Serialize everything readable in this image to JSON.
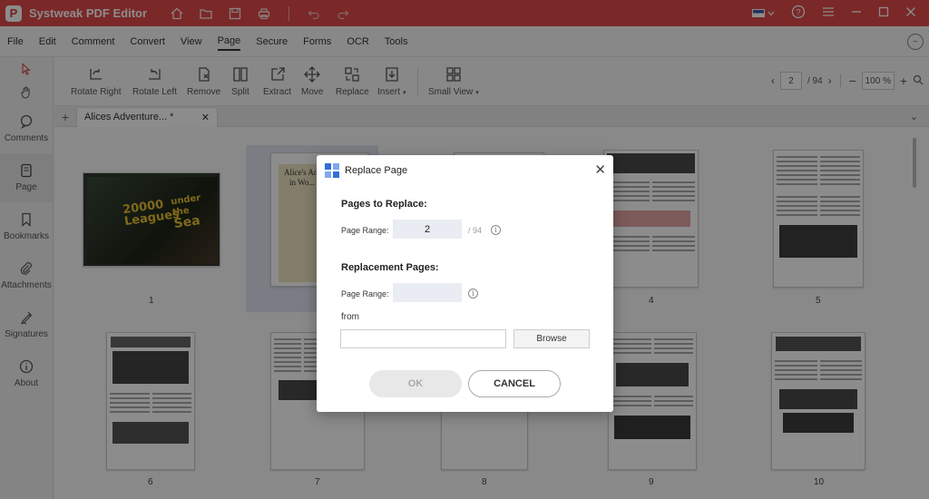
{
  "app": {
    "title": "Systweak PDF Editor",
    "logo_letter": "P"
  },
  "menu": [
    {
      "label": "File"
    },
    {
      "label": "Edit"
    },
    {
      "label": "Comment"
    },
    {
      "label": "Convert"
    },
    {
      "label": "View"
    },
    {
      "label": "Page"
    },
    {
      "label": "Secure"
    },
    {
      "label": "Forms"
    },
    {
      "label": "OCR"
    },
    {
      "label": "Tools"
    }
  ],
  "sidebar": [
    {
      "label": "Comments"
    },
    {
      "label": "Page"
    },
    {
      "label": "Bookmarks"
    },
    {
      "label": "Attachments"
    },
    {
      "label": "Signatures"
    },
    {
      "label": "About"
    }
  ],
  "toolbar": {
    "tools": [
      {
        "label": "Rotate Right"
      },
      {
        "label": "Rotate Left"
      },
      {
        "label": "Remove"
      },
      {
        "label": "Split"
      },
      {
        "label": "Extract"
      },
      {
        "label": "Move"
      },
      {
        "label": "Replace"
      },
      {
        "label": "Insert"
      },
      {
        "label": "Small View"
      }
    ],
    "current_page": "2",
    "total_pages": "/ 94",
    "zoom": "100 %"
  },
  "tabs": {
    "doc_tab": "Alices Adventure... *"
  },
  "thumbnails": {
    "page_numbers": [
      "1",
      "4",
      "5",
      "6",
      "7",
      "8",
      "9",
      "10"
    ],
    "book_title_lines": [
      "20000",
      "Leagues",
      "under",
      "the",
      "Sea"
    ],
    "page2_title": "Alice's Ad...",
    "page2_sub": "in Wo..."
  },
  "dialog": {
    "title": "Replace Page",
    "pages_to_replace": "Pages to Replace:",
    "page_range_label": "Page Range:",
    "page_range_value": "2",
    "of_total": "/ 94",
    "replacement_pages": "Replacement Pages:",
    "replacement_range_label": "Page Range:",
    "replacement_range_value": "",
    "from_label": "from",
    "from_value": "",
    "browse": "Browse",
    "ok": "OK",
    "cancel": "CANCEL"
  },
  "colors": {
    "title_bar": "#e04a4a",
    "dialog_accent": "#2f6fd8"
  }
}
